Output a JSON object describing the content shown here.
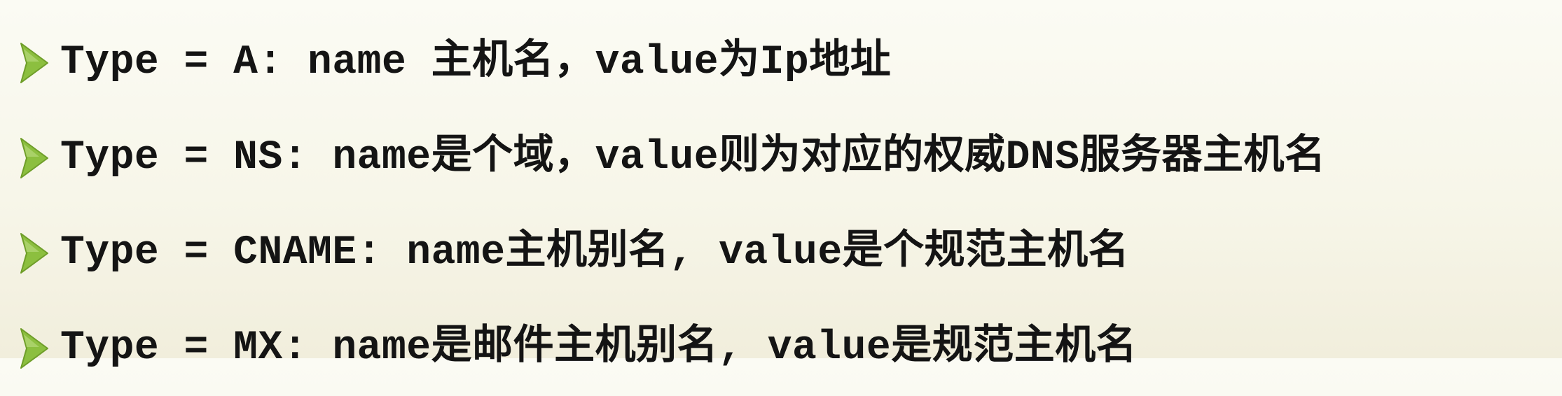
{
  "slide": {
    "bullets": [
      {
        "text": "Type = A: name 主机名，value为Ip地址"
      },
      {
        "text": "Type = NS: name是个域，value则为对应的权威DNS服务器主机名"
      },
      {
        "text": "Type = CNAME: name主机别名, value是个规范主机名"
      },
      {
        "text": "Type = MX: name是邮件主机别名, value是规范主机名"
      }
    ],
    "bullet_icon": "triangle-arrow-icon",
    "colors": {
      "bullet_accent": "#8cbf3f",
      "text": "#141414",
      "background": "#f7f6e9"
    }
  }
}
